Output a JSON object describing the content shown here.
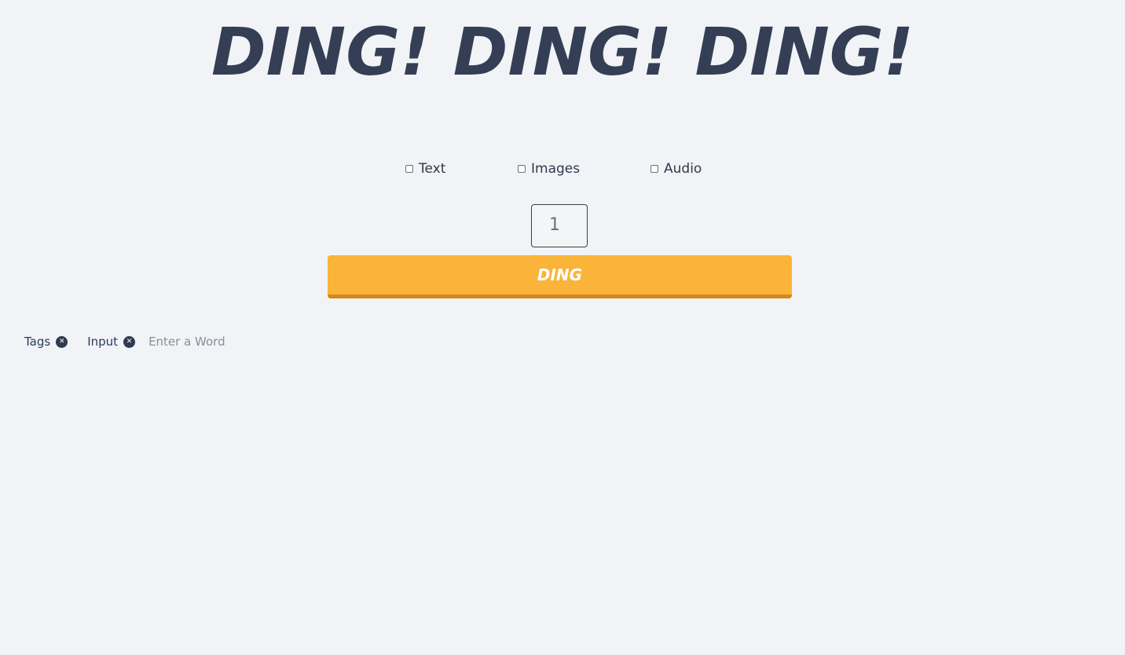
{
  "header": {
    "title": "DING! DING! DING!"
  },
  "options": [
    {
      "label": "Text",
      "checked": false
    },
    {
      "label": "Images",
      "checked": false
    },
    {
      "label": "Audio",
      "checked": false
    }
  ],
  "count": {
    "value": "1"
  },
  "ding_button": {
    "label": "DING",
    "color": "#fab43a"
  },
  "tags": [
    {
      "label": "Tags",
      "close_icon": "close-circle-icon"
    },
    {
      "label": "Input",
      "close_icon": "close-circle-icon"
    }
  ],
  "word_input": {
    "placeholder": "Enter a Word",
    "value": ""
  },
  "colors": {
    "background": "#f1f3f6",
    "title": "#343e54",
    "accent": "#fab43a"
  }
}
